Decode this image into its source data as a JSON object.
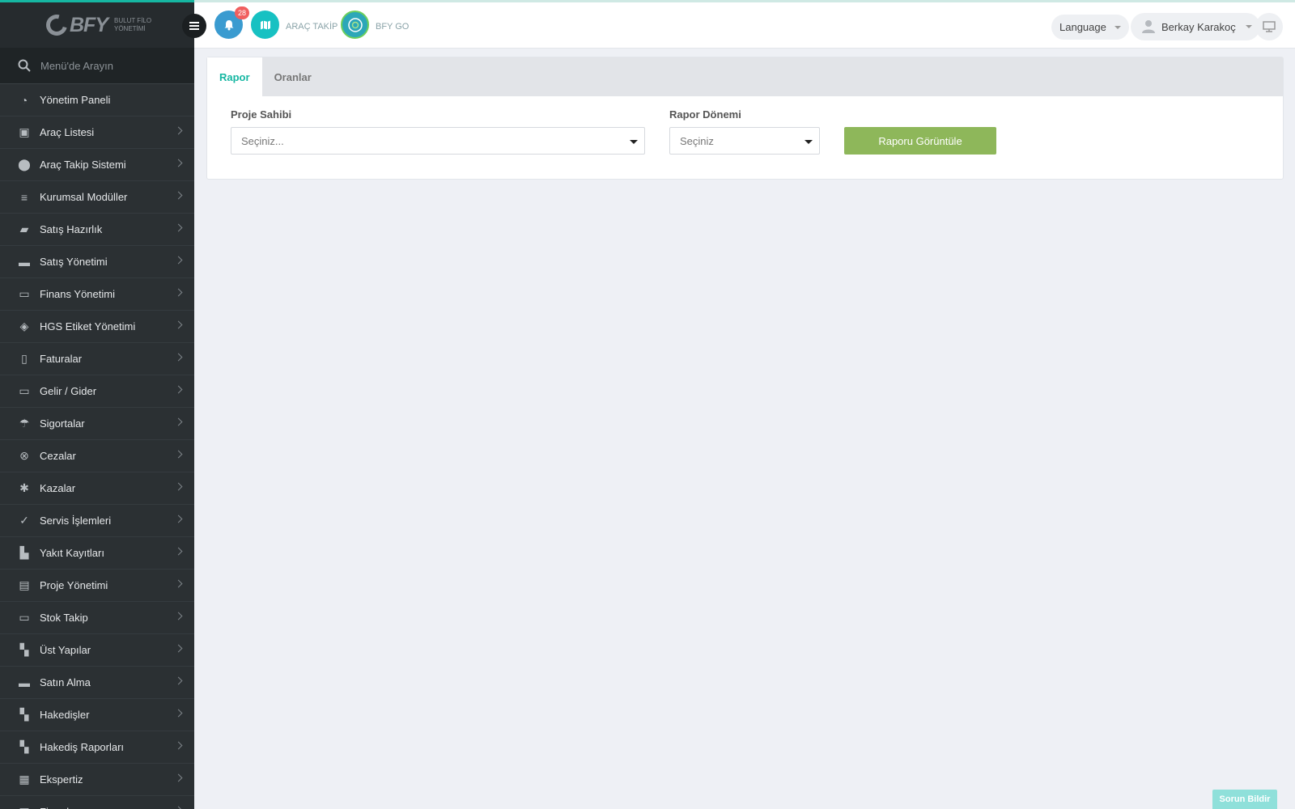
{
  "brand": {
    "name": "BFY",
    "subtitle_line1": "BULUT FİLO",
    "subtitle_line2": "YÖNETİMİ"
  },
  "sidebar": {
    "search_placeholder": "Menü'de Arayın",
    "items": [
      {
        "label": "Yönetim Paneli",
        "icon": "dashboard-icon",
        "has_children": false
      },
      {
        "label": "Araç Listesi",
        "icon": "bus-icon",
        "has_children": true
      },
      {
        "label": "Araç Takip Sistemi",
        "icon": "map-pin-icon",
        "has_children": true
      },
      {
        "label": "Kurumsal Modüller",
        "icon": "server-icon",
        "has_children": true
      },
      {
        "label": "Satış Hazırlık",
        "icon": "book-icon",
        "has_children": true
      },
      {
        "label": "Satış Yönetimi",
        "icon": "credit-card-icon",
        "has_children": true
      },
      {
        "label": "Finans Yönetimi",
        "icon": "money-icon",
        "has_children": true
      },
      {
        "label": "HGS Etiket Yönetimi",
        "icon": "tag-icon",
        "has_children": true
      },
      {
        "label": "Faturalar",
        "icon": "file-icon",
        "has_children": true
      },
      {
        "label": "Gelir / Gider",
        "icon": "money-icon",
        "has_children": true
      },
      {
        "label": "Sigortalar",
        "icon": "umbrella-icon",
        "has_children": true
      },
      {
        "label": "Cezalar",
        "icon": "times-circle-icon",
        "has_children": true
      },
      {
        "label": "Kazalar",
        "icon": "car-crash-icon",
        "has_children": true
      },
      {
        "label": "Servis İşlemleri",
        "icon": "check-circle-icon",
        "has_children": true
      },
      {
        "label": "Yakıt Kayıtları",
        "icon": "fuel-icon",
        "has_children": true
      },
      {
        "label": "Proje Yönetimi",
        "icon": "briefcase-icon",
        "has_children": true
      },
      {
        "label": "Stok Takip",
        "icon": "inbox-icon",
        "has_children": true
      },
      {
        "label": "Üst Yapılar",
        "icon": "truck-icon",
        "has_children": true
      },
      {
        "label": "Satın Alma",
        "icon": "credit-card-icon",
        "has_children": true
      },
      {
        "label": "Hakedişler",
        "icon": "truck-icon",
        "has_children": true
      },
      {
        "label": "Hakediş Raporları",
        "icon": "truck-icon",
        "has_children": true
      },
      {
        "label": "Ekspertiz",
        "icon": "report-icon",
        "has_children": true
      },
      {
        "label": "Firmalar",
        "icon": "building-icon",
        "has_children": true
      }
    ]
  },
  "topbar": {
    "notification_count": "28",
    "arac_takip_label": "ARAÇ TAKİP",
    "bfy_go_label": "BFY GO",
    "language_label": "Language",
    "user_name": "Berkay Karakoç"
  },
  "tabs": [
    {
      "label": "Rapor",
      "active": true
    },
    {
      "label": "Oranlar",
      "active": false
    }
  ],
  "form": {
    "proje_sahibi_label": "Proje Sahibi",
    "proje_sahibi_value": "Seçiniz...",
    "rapor_donemi_label": "Rapor Dönemi",
    "rapor_donemi_value": "Seçiniz",
    "view_button_label": "Raporu Görüntüle"
  },
  "report_issue_label": "Sorun Bildir",
  "colors": {
    "accent": "#16b7a2",
    "sidebar_bg": "#2b3033",
    "button_green": "#8eb75a",
    "badge_red": "#f05f5f"
  }
}
